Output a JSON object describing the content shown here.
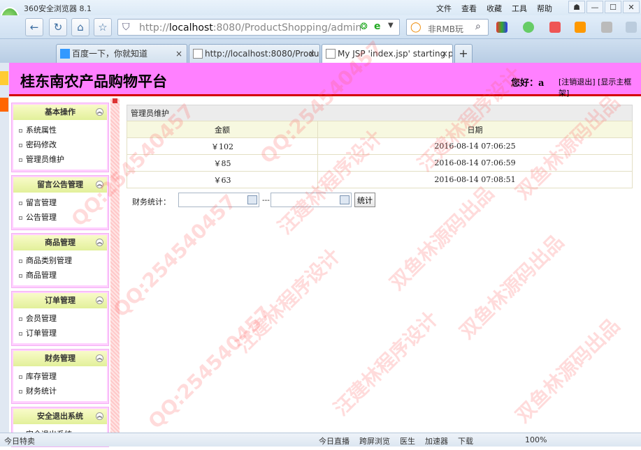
{
  "browser": {
    "app_title": "360安全浏览器 8.1",
    "menu": [
      "文件",
      "查看",
      "收藏",
      "工具",
      "帮助"
    ],
    "address_host": "localhost",
    "address_prefix": "http://",
    "address_rest": ":8080/ProductShopping/admin/i",
    "search_text": "非RMB玩",
    "tabs": [
      {
        "label": "百度一下，你就知道"
      },
      {
        "label": "http://localhost:8080/Produ"
      },
      {
        "label": "My JSP 'index.jsp' starting p"
      }
    ],
    "tab_close": "×",
    "new_tab": "+"
  },
  "header": {
    "title": "桂东南农产品购物平台",
    "greeting": "您好：a",
    "links": "[注销退出] [显示主框架]"
  },
  "sidebar": {
    "sections": [
      {
        "title": "基本操作",
        "items": [
          "系统属性",
          "密码修改",
          "管理员维护"
        ]
      },
      {
        "title": "留言公告管理",
        "items": [
          "留言管理",
          "公告管理"
        ]
      },
      {
        "title": "商品管理",
        "items": [
          "商品类别管理",
          "商品管理"
        ]
      },
      {
        "title": "订单管理",
        "items": [
          "会员管理",
          "订单管理"
        ]
      },
      {
        "title": "财务管理",
        "items": [
          "库存管理",
          "财务统计"
        ]
      },
      {
        "title": "安全退出系统",
        "items": [
          "安全退出系统"
        ]
      }
    ]
  },
  "content": {
    "caption": "管理员维护",
    "columns": [
      "金额",
      "日期"
    ],
    "rows": [
      {
        "amount": "￥102",
        "date": "2016-08-14 07:06:25"
      },
      {
        "amount": "￥85",
        "date": "2016-08-14 07:06:59"
      },
      {
        "amount": "￥63",
        "date": "2016-08-14 07:08:51"
      }
    ],
    "stat_label": "财务统计：",
    "range_sep": "---",
    "stat_button": "统计",
    "date_from": "",
    "date_to": ""
  },
  "statusbar": {
    "left": "今日特卖",
    "items": [
      "今日直播",
      "跨屏浏览",
      "医生",
      "加速器",
      "下载"
    ],
    "zoom": "100%"
  },
  "watermarks": [
    "QQ:254540457",
    "汪建林程序设计",
    "双鱼林源码出品"
  ]
}
